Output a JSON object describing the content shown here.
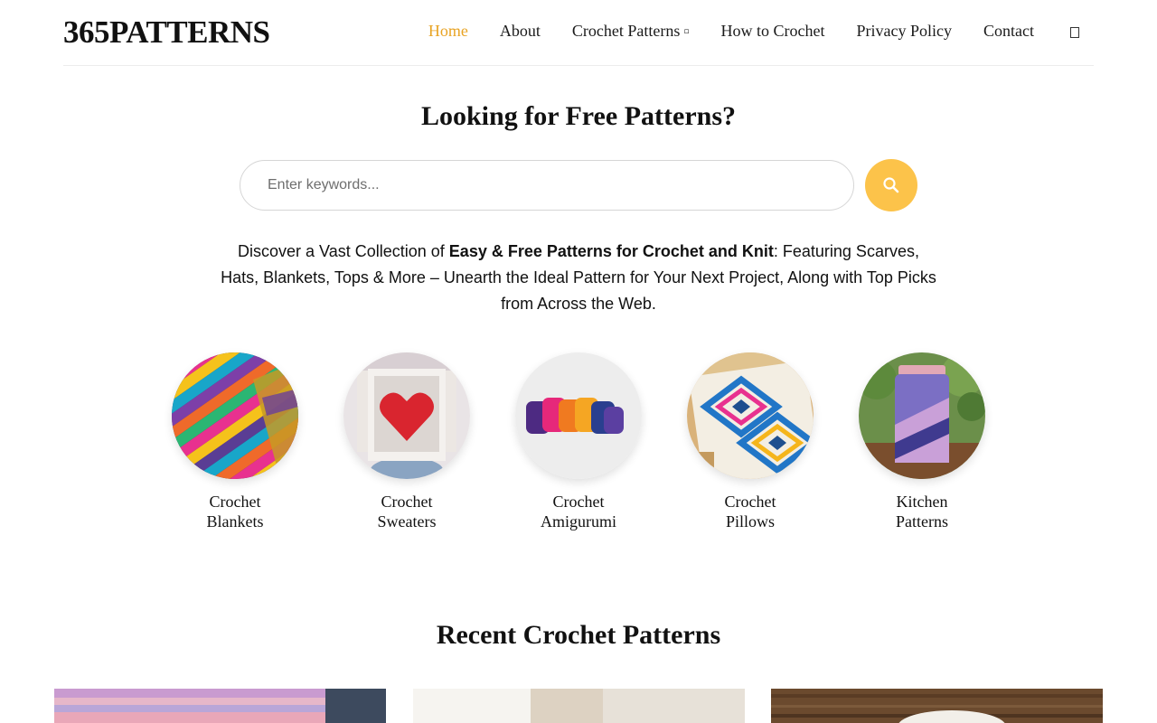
{
  "header": {
    "logo": "365PATTERNS",
    "nav": [
      {
        "label": "Home",
        "active": true
      },
      {
        "label": "About"
      },
      {
        "label": "Crochet Patterns",
        "dropdown": true
      },
      {
        "label": "How to Crochet"
      },
      {
        "label": "Privacy Policy"
      },
      {
        "label": "Contact"
      }
    ],
    "dropdown_glyph": "▫",
    "search_icon": "search-toggle-icon"
  },
  "hero": {
    "title": "Looking for Free Patterns?",
    "search_placeholder": "Enter keywords...",
    "search_value": "",
    "search_button_icon": "magnifier-icon",
    "intro_pre": "Discover a Vast Collection of ",
    "intro_bold": "Easy & Free Patterns for Crochet and Knit",
    "intro_post": ": Featuring Scarves, Hats, Blankets, Tops & More – Unearth the Ideal Pattern for Your Next Project, Along with Top Picks from Across the Web."
  },
  "categories": [
    {
      "line1": "Crochet",
      "line2": "Blankets"
    },
    {
      "line1": "Crochet",
      "line2": "Sweaters"
    },
    {
      "line1": "Crochet",
      "line2": "Amigurumi"
    },
    {
      "line1": "Crochet",
      "line2": "Pillows"
    },
    {
      "line1": "Kitchen",
      "line2": "Patterns"
    }
  ],
  "recent": {
    "title": "Recent Crochet Patterns"
  },
  "colors": {
    "accent": "#e8a323",
    "search_button": "#fcc34a",
    "text": "#111111",
    "border": "#d6d6d6"
  }
}
